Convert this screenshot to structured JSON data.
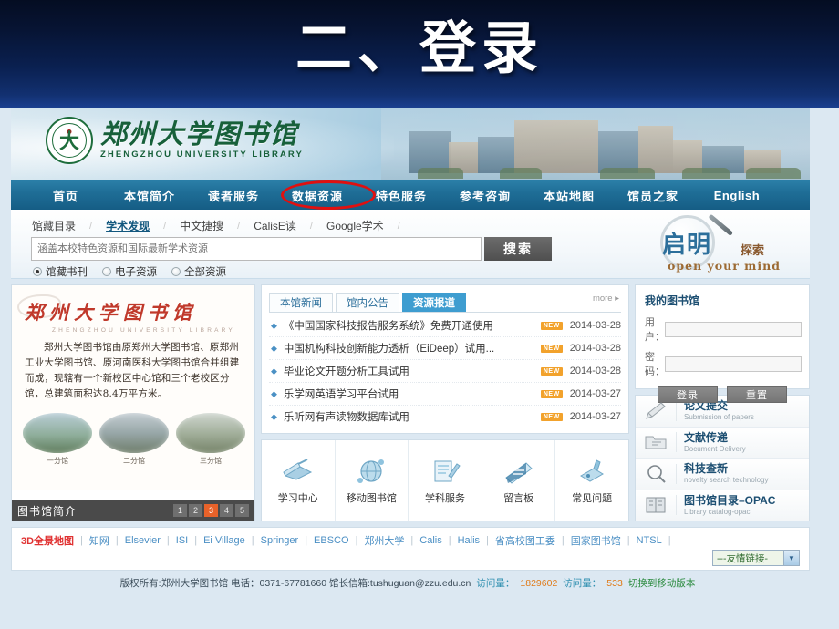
{
  "slide": {
    "title": "二、登录"
  },
  "site": {
    "logo": {
      "cn": "郑州大学图书馆",
      "en": "ZHENGZHOU UNIVERSITY LIBRARY",
      "seal_mark": "大"
    },
    "nav": [
      {
        "label": "首页",
        "name": "home"
      },
      {
        "label": "本馆简介",
        "name": "about"
      },
      {
        "label": "读者服务",
        "name": "reader-service"
      },
      {
        "label": "数据资源",
        "name": "data-resources",
        "highlighted": true
      },
      {
        "label": "特色服务",
        "name": "featured-service"
      },
      {
        "label": "参考咨询",
        "name": "reference"
      },
      {
        "label": "本站地图",
        "name": "sitemap"
      },
      {
        "label": "馆员之家",
        "name": "staff"
      },
      {
        "label": "English",
        "name": "english"
      }
    ]
  },
  "search": {
    "tabs": [
      {
        "label": "馆藏目录",
        "active": false
      },
      {
        "label": "学术发现",
        "active": true
      },
      {
        "label": "中文捷搜",
        "active": false
      },
      {
        "label": "CalisE读",
        "active": false
      },
      {
        "label": "Google学术",
        "active": false
      }
    ],
    "placeholder": "涵盖本校特色资源和国际最新学术资源",
    "value": "",
    "button": "搜索",
    "scopes": [
      {
        "label": "馆藏书刊",
        "selected": true
      },
      {
        "label": "电子资源",
        "selected": false
      },
      {
        "label": "全部资源",
        "selected": false
      }
    ],
    "brand": {
      "cn": "启明",
      "suffix": "探索",
      "en": "open your mind"
    }
  },
  "intro": {
    "heading_cn": "郑州大学图书馆",
    "heading_en": "ZHENGZHOU UNIVERSITY LIBRARY",
    "body": "郑州大学图书馆由原郑州大学图书馆、原郑州工业大学图书馆、原河南医科大学图书馆合并组建而成，现辖有一个新校区中心馆和三个老校区分馆，总建筑面积达8.4万平方米。",
    "photos": [
      {
        "caption": "一分馆"
      },
      {
        "caption": "二分馆"
      },
      {
        "caption": "三分馆"
      }
    ],
    "caption": "图书馆简介",
    "pages": [
      "1",
      "2",
      "3",
      "4",
      "5"
    ],
    "active_page": "3"
  },
  "news": {
    "tabs": [
      {
        "label": "本馆新闻",
        "active": false
      },
      {
        "label": "馆内公告",
        "active": false
      },
      {
        "label": "资源报道",
        "active": true
      }
    ],
    "more": "more ▸",
    "items": [
      {
        "title": "《中国国家科技报告服务系统》免费开通使用",
        "badge": "NEW",
        "date": "2014-03-28"
      },
      {
        "title": "中国机构科技创新能力透析（EiDeep）试用...",
        "badge": "NEW",
        "date": "2014-03-28"
      },
      {
        "title": "毕业论文开题分析工具试用",
        "badge": "NEW",
        "date": "2014-03-28"
      },
      {
        "title": "乐学网英语学习平台试用",
        "badge": "NEW",
        "date": "2014-03-27"
      },
      {
        "title": "乐听网有声读物数据库试用",
        "badge": "NEW",
        "date": "2014-03-27"
      }
    ]
  },
  "quick_links": [
    {
      "label": "学习中心",
      "icon": "study-center-icon"
    },
    {
      "label": "移动图书馆",
      "icon": "mobile-library-icon"
    },
    {
      "label": "学科服务",
      "icon": "subject-service-icon"
    },
    {
      "label": "留言板",
      "icon": "message-board-icon"
    },
    {
      "label": "常见问题",
      "icon": "faq-icon"
    }
  ],
  "my_library": {
    "title": "我的图书馆",
    "user_label": "用户：",
    "user_value": "",
    "password_label": "密码：",
    "password_value": "",
    "login_button": "登录",
    "reset_button": "重置"
  },
  "services": [
    {
      "cn": "论文提交",
      "en": "Submission of papers",
      "icon": "pencil-icon"
    },
    {
      "cn": "文献传递",
      "en": "Document Delivery",
      "icon": "folder-icon"
    },
    {
      "cn": "科技查新",
      "en": "novelty search technology",
      "icon": "magnifier-icon"
    },
    {
      "cn": "图书馆目录–OPAC",
      "en": "Library catalog-opac",
      "icon": "catalog-icon"
    }
  ],
  "footer": {
    "links": [
      {
        "label": "3D全景地图",
        "red": true
      },
      {
        "label": "知网",
        "red": false
      },
      {
        "label": "Elsevier",
        "red": false
      },
      {
        "label": "ISI",
        "red": false
      },
      {
        "label": "Ei Village",
        "red": false
      },
      {
        "label": "Springer",
        "red": false
      },
      {
        "label": "EBSCO",
        "red": false
      },
      {
        "label": "郑州大学",
        "red": false
      },
      {
        "label": "Calis",
        "red": false
      },
      {
        "label": "Halis",
        "red": false
      },
      {
        "label": "省高校图工委",
        "red": false
      },
      {
        "label": "国家图书馆",
        "red": false
      },
      {
        "label": "NTSL",
        "red": false
      }
    ],
    "select_value": "---友情链接-",
    "copyright": "版权所有:郑州大学图书馆  电话：0371-67781660  馆长信箱:tushuguan@zzu.edu.cn",
    "visits_label_1": "访问量：",
    "visits_value_1": "1829602",
    "visits_label_2": "访问量：",
    "visits_value_2": "533",
    "mobile_link": "切换到移动版本"
  },
  "colors": {
    "slide_bg_dark": "#040d22",
    "slide_bg_light": "#1a3f8f",
    "nav_blue": "#1f6e97",
    "highlight_red": "#e01010",
    "active_tab_blue": "#3e9dd0",
    "badge_orange": "#f2a22c",
    "pager_active": "#e8622a",
    "link_blue": "#4b8fc4",
    "page_bg": "#dce8f2"
  }
}
